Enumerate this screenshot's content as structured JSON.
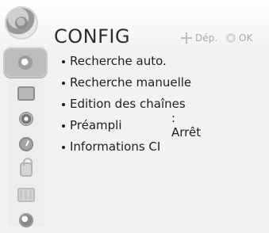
{
  "header": {
    "title": "CONFIG",
    "hint_move": "Dép.",
    "hint_ok": "OK"
  },
  "sidebar": {
    "items": [
      {
        "icon": "disc-icon",
        "selected": true
      },
      {
        "icon": "monitor-icon",
        "selected": false
      },
      {
        "icon": "speaker-icon",
        "selected": false
      },
      {
        "icon": "clock-icon",
        "selected": false
      },
      {
        "icon": "lock-icon",
        "selected": false
      },
      {
        "icon": "film-icon",
        "selected": false
      },
      {
        "icon": "globe-icon",
        "selected": false
      }
    ]
  },
  "menu": {
    "items": [
      {
        "label": "Recherche auto.",
        "value": ""
      },
      {
        "label": "Recherche manuelle",
        "value": ""
      },
      {
        "label": "Edition des chaînes",
        "value": ""
      },
      {
        "label": "Préampli",
        "value": ": Arrêt"
      },
      {
        "label": "Informations CI",
        "value": ""
      }
    ]
  }
}
